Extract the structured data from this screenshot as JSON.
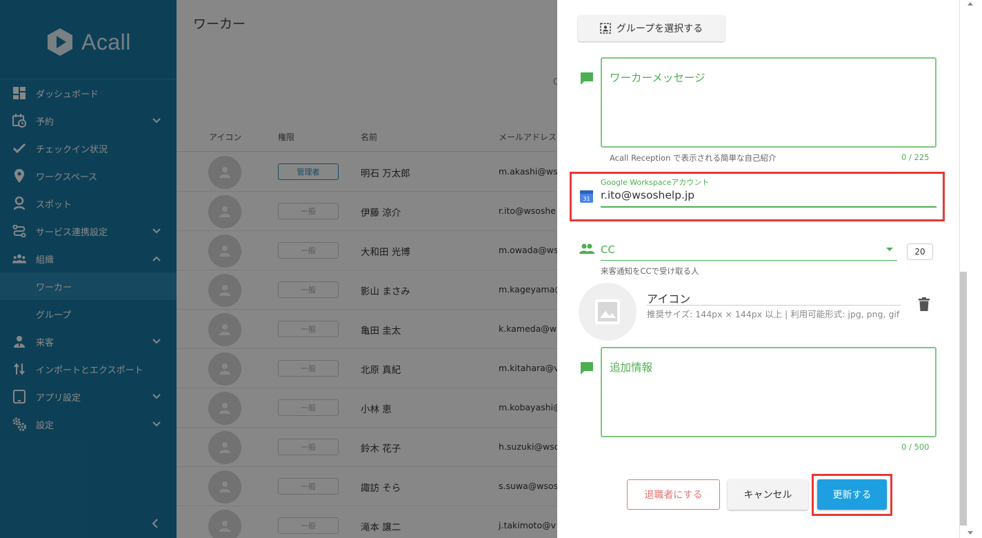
{
  "brand": {
    "name": "Acall"
  },
  "sidebar": {
    "items": [
      {
        "label": "ダッシュボード",
        "icon": "dashboard-icon",
        "expandable": false
      },
      {
        "label": "予約",
        "icon": "calendar-clock-icon",
        "expandable": true
      },
      {
        "label": "チェックイン状況",
        "icon": "check-icon",
        "expandable": false
      },
      {
        "label": "ワークスペース",
        "icon": "location-pin-icon",
        "expandable": false
      },
      {
        "label": "スポット",
        "icon": "person-pin-icon",
        "expandable": false
      },
      {
        "label": "サービス連携設定",
        "icon": "integration-icon",
        "expandable": true
      },
      {
        "label": "組織",
        "icon": "people-icon",
        "expandable": true,
        "expanded": true
      }
    ],
    "sub_items": [
      {
        "label": "ワーカー",
        "active": true
      },
      {
        "label": "グループ",
        "active": false
      }
    ],
    "items_after": [
      {
        "label": "来客",
        "icon": "visitor-icon",
        "expandable": true
      },
      {
        "label": "インポートとエクスポート",
        "icon": "import-export-icon",
        "expandable": false
      },
      {
        "label": "アプリ設定",
        "icon": "tablet-icon",
        "expandable": true
      },
      {
        "label": "設定",
        "icon": "gears-icon",
        "expandable": true
      }
    ]
  },
  "main": {
    "title": "ワーカー",
    "tab_fragment": "G",
    "columns": [
      "アイコン",
      "権限",
      "名前",
      "メールアドレス"
    ],
    "rows": [
      {
        "role": "管理者",
        "admin": true,
        "name": "明石 万太郎",
        "email": "m.akashi@ws"
      },
      {
        "role": "一般",
        "admin": false,
        "name": "伊藤 涼介",
        "email": "r.ito@wsoshe"
      },
      {
        "role": "一般",
        "admin": false,
        "name": "大和田 光博",
        "email": "m.owada@ws"
      },
      {
        "role": "一般",
        "admin": false,
        "name": "影山 まさみ",
        "email": "m.kageyama@"
      },
      {
        "role": "一般",
        "admin": false,
        "name": "亀田 圭太",
        "email": "k.kameda@w"
      },
      {
        "role": "一般",
        "admin": false,
        "name": "北原 真紀",
        "email": "m.kitahara@v"
      },
      {
        "role": "一般",
        "admin": false,
        "name": "小林 恵",
        "email": "m.kobayashi@"
      },
      {
        "role": "一般",
        "admin": false,
        "name": "鈴木 花子",
        "email": "h.suzuki@wso"
      },
      {
        "role": "一般",
        "admin": false,
        "name": "諏訪 そら",
        "email": "s.suwa@wsos"
      },
      {
        "role": "一般",
        "admin": false,
        "name": "滝本 譲二",
        "email": "j.takimoto@v"
      }
    ]
  },
  "panel": {
    "group_button": "グループを選択する",
    "worker_message": {
      "placeholder": "ワーカーメッセージ",
      "hint": "Acall Reception で表示される簡単な自己紹介",
      "counter": "0 / 225"
    },
    "google_workspace": {
      "label": "Google Workspaceアカウント",
      "value": "r.ito@wsoshelp.jp"
    },
    "cc": {
      "label": "CC",
      "hint": "来客通知をCCで受け取る人",
      "number": "20"
    },
    "icon_upload": {
      "title": "アイコン",
      "subtitle": "推奨サイズ: 144px × 144px 以上 | 利用可能形式: jpg, png, gif"
    },
    "additional_info": {
      "placeholder": "追加情報",
      "counter": "0 / 500"
    },
    "buttons": {
      "retire": "退職者にする",
      "cancel": "キャンセル",
      "update": "更新する"
    }
  },
  "colors": {
    "sidebar": "#1a7aa5",
    "accent_green": "#4caf50",
    "primary_blue": "#1e9fe0",
    "highlight_red": "#e53935"
  }
}
